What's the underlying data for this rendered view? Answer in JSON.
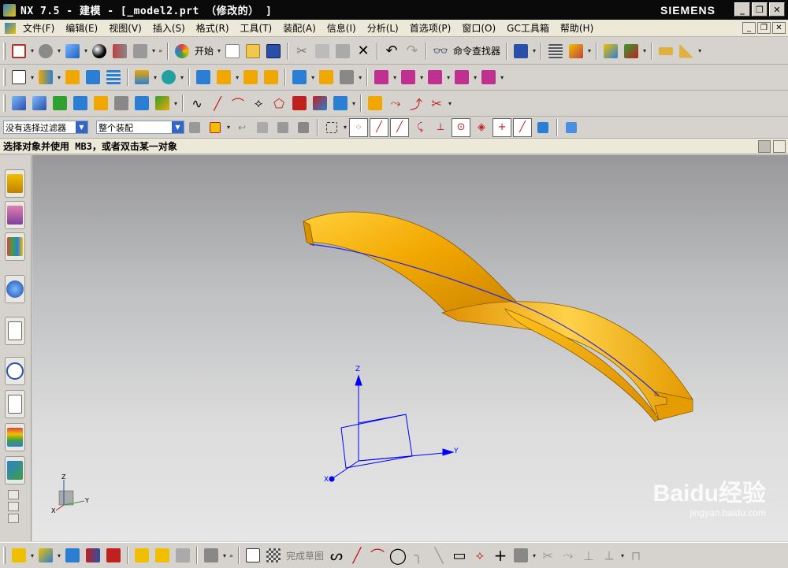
{
  "window": {
    "title": "NX 7.5 - 建模 - [_model2.prt （修改的） ]",
    "brand": "SIEMENS",
    "buttons": [
      "minimize",
      "restore",
      "close"
    ]
  },
  "menubar": {
    "items": [
      "文件(F)",
      "编辑(E)",
      "视图(V)",
      "插入(S)",
      "格式(R)",
      "工具(T)",
      "装配(A)",
      "信息(I)",
      "分析(L)",
      "首选项(P)",
      "窗口(O)",
      "GC工具箱",
      "帮助(H)"
    ]
  },
  "toolbar_standard": {
    "start_label": "开始",
    "command_finder_label": "命令查找器"
  },
  "selection_bar": {
    "filter_value": "没有选择过滤器",
    "scope_value": "整个装配"
  },
  "cue_line": "选择对象并使用 MB3，或者双击某一对象",
  "sketch_bar": {
    "finish_sketch_label": "完成草图"
  },
  "triad": {
    "axis_x": "X",
    "axis_y": "Y",
    "axis_z": "Z"
  },
  "watermark": {
    "brand": "Baidu经验",
    "url": "jingyan.baidu.com"
  },
  "colors": {
    "model_gold": "#f0a800",
    "edge_blue": "#2828e6",
    "wcs_blue": "#0000ff"
  }
}
